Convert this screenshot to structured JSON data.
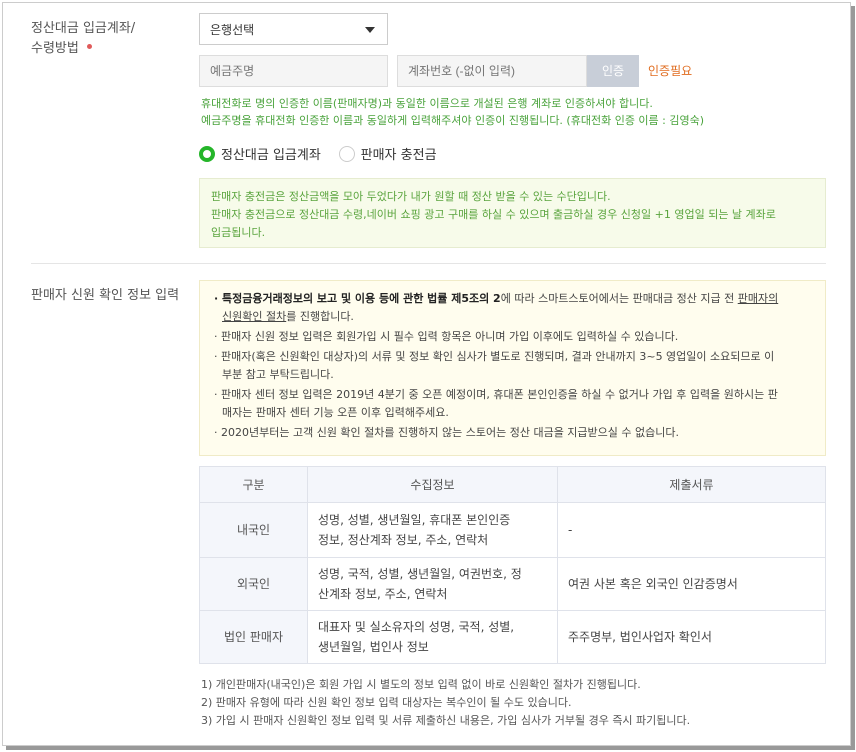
{
  "settlement": {
    "label_line1": "정산대금 입금계좌/",
    "label_line2": "수령방법",
    "bank_select_value": "은행선택",
    "depositor_placeholder": "예금주명",
    "account_placeholder": "계좌번호 (-없이 입력)",
    "verify_button": "인증",
    "verify_status": "인증필요",
    "notes": [
      "휴대전화로 명의 인증한 이름(판매자명)과 동일한 이름으로 개설된 은행 계좌로 인증하셔야 합니다.",
      "예금주명을 휴대전화 인증한 이름과 동일하게 입력해주셔야 인증이 진행됩니다. (휴대전화 인증 이름 : 김영숙)"
    ],
    "radio_options": [
      {
        "label": "정산대금 입금계좌",
        "selected": true
      },
      {
        "label": "판매자 충전금",
        "selected": false
      }
    ],
    "charge_info": [
      "판매자 충전금은 정산금액을 모아 두었다가 내가 원할 때 정산 받을 수 있는 수단입니다.",
      "판매자 충전금으로 정산대금 수령,네이버 쇼핑 광고 구매를 하실 수 있으며 출금하실 경우 신청일 +1 영업일 되는 날 계좌로",
      "입금됩니다."
    ]
  },
  "identity": {
    "label": "판매자 신원 확인 정보 입력",
    "info": {
      "item1_bold": "· 특정금융거래정보의 보고 및 이용 등에 관한 법률 제5조의 2",
      "item1_rest": "에 따라 스마트스토어에서는 판매대금 정산 지급 전 ",
      "item1_link_a": "판매자의",
      "item1_link_b": "신원확인 절차",
      "item1_end": "를 진행합니다.",
      "item2": "· 판매자 신원 정보 입력은 회원가입 시 필수 입력 항목은 아니며 가입 이후에도 입력하실 수 있습니다.",
      "item3_a": "· 판매자(혹은 신원확인 대상자)의 서류 및 정보 확인 심사가 별도로 진행되며, 결과 안내까지 3~5 영업일이 소요되므로 이",
      "item3_b": "부분 참고 부탁드립니다.",
      "item4_a": "· 판매자 센터 정보 입력은 2019년 4분기 중 오픈 예정이며, 휴대폰 본인인증을 하실 수 없거나 가입 후 입력을 원하시는 판",
      "item4_b": "매자는 판매자 센터 기능 오픈 이후 입력해주세요.",
      "item5": "· 2020년부터는 고객 신원 확인 절차를 진행하지 않는 스토어는 정산 대금을 지급받으실 수 없습니다."
    },
    "table": {
      "headers": [
        "구분",
        "수집정보",
        "제출서류"
      ],
      "rows": [
        {
          "type": "내국인",
          "info_a": "성명, 성별, 생년월일, 휴대폰 본인인증",
          "info_b": "정보, 정산계좌 정보, 주소, 연락처",
          "docs": "-"
        },
        {
          "type": "외국인",
          "info_a": "성명, 국적, 성별, 생년월일, 여권번호, 정",
          "info_b": "산계좌 정보, 주소, 연락처",
          "docs": "여권 사본 혹은 외국인 인감증명서"
        },
        {
          "type": "법인 판매자",
          "info_a": "대표자 및 실소유자의 성명, 국적, 성별,",
          "info_b": "생년월일, 법인사 정보",
          "docs": "주주명부, 법인사업자 확인서"
        }
      ]
    },
    "footnotes": [
      "1) 개인판매자(내국인)은 회원 가입 시 별도의 정보 입력 없이 바로 신원확인 절차가 진행됩니다.",
      "2) 판매자 유형에 따라 신원 확인 정보 입력 대상자는 복수인이 될 수도 있습니다.",
      "3) 가입 시 판매자 신원확인 정보 입력 및 서류 제출하신 내용은, 가입 심사가 거부될 경우 즉시 파기됩니다."
    ]
  }
}
